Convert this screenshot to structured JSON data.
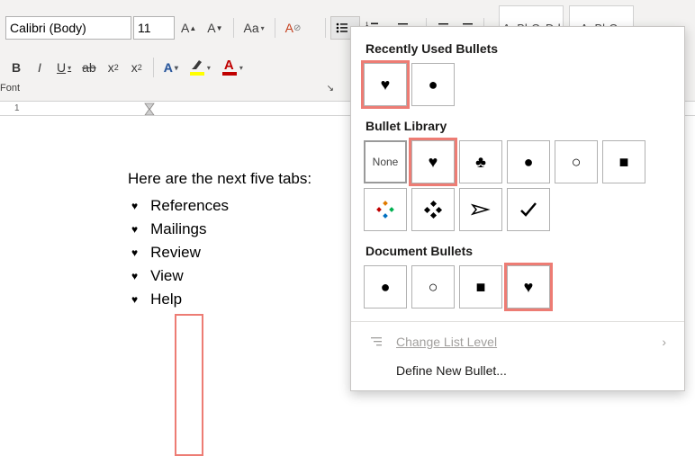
{
  "ribbon": {
    "font_name": "Calibri (Body)",
    "font_size": "11",
    "group_label": "Font"
  },
  "styles": {
    "sample1": "AaBbCcDd",
    "sample2": "AaBbCc"
  },
  "document": {
    "intro": "Here are the next five tabs:",
    "items": [
      "References",
      "Mailings",
      "Review",
      "View",
      "Help"
    ]
  },
  "dropdown": {
    "recent_title": "Recently Used Bullets",
    "library_title": "Bullet Library",
    "doc_title": "Document Bullets",
    "none_label": "None",
    "change_level": "Change List Level",
    "define_new": "Define New Bullet..."
  },
  "ruler": {
    "mark1": "1"
  }
}
